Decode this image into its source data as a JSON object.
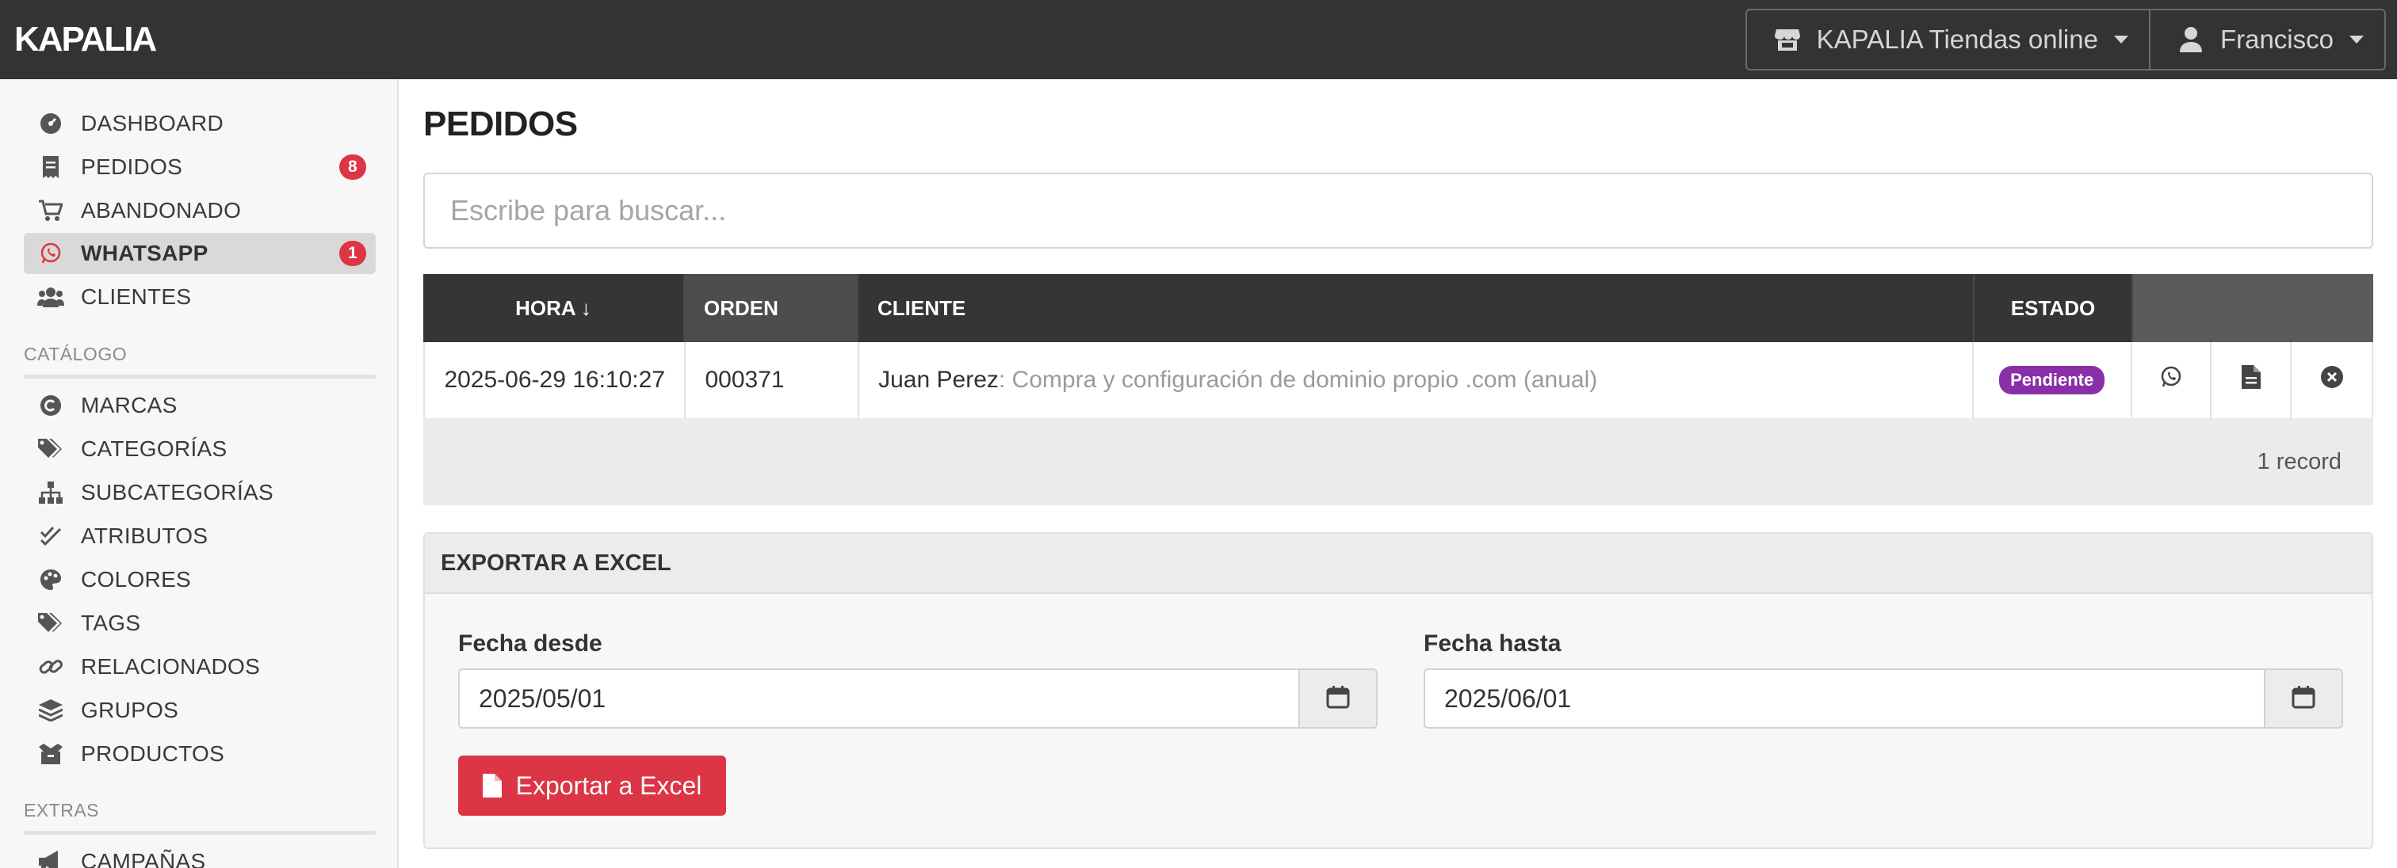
{
  "app": {
    "logo_text": "KAPALIA",
    "store_selector": "KAPALIA Tiendas online",
    "user_menu": "Francisco"
  },
  "sidebar": {
    "main_items": [
      {
        "label": "DASHBOARD",
        "icon": "dashboard-icon"
      },
      {
        "label": "PEDIDOS",
        "icon": "receipt-icon",
        "badge": "8"
      },
      {
        "label": "ABANDONADO",
        "icon": "cart-icon"
      },
      {
        "label": "WHATSAPP",
        "icon": "whatsapp-icon",
        "badge": "1",
        "active": true
      },
      {
        "label": "CLIENTES",
        "icon": "users-icon"
      }
    ],
    "catalog_title": "CATÁLOGO",
    "catalog_items": [
      {
        "label": "MARCAS",
        "icon": "copyright-icon"
      },
      {
        "label": "CATEGORÍAS",
        "icon": "tags-icon"
      },
      {
        "label": "SUBCATEGORÍAS",
        "icon": "sitemap-icon"
      },
      {
        "label": "ATRIBUTOS",
        "icon": "check-double-icon"
      },
      {
        "label": "COLORES",
        "icon": "palette-icon"
      },
      {
        "label": "TAGS",
        "icon": "tags-icon"
      },
      {
        "label": "RELACIONADOS",
        "icon": "link-icon"
      },
      {
        "label": "GRUPOS",
        "icon": "layers-icon"
      },
      {
        "label": "PRODUCTOS",
        "icon": "box-icon"
      }
    ],
    "extras_title": "EXTRAS",
    "extras_items": [
      {
        "label": "CAMPAÑAS",
        "icon": "megaphone-icon"
      }
    ]
  },
  "main": {
    "title": "PEDIDOS",
    "search_placeholder": "Escribe para buscar...",
    "table": {
      "headers": {
        "hora": "HORA ↓",
        "orden": "ORDEN",
        "cliente": "CLIENTE",
        "estado": "ESTADO"
      },
      "rows": [
        {
          "hora": "2025-06-29 16:10:27",
          "orden": "000371",
          "cliente_name": "Juan Perez",
          "cliente_detail": ": Compra y configuración de dominio propio .com (anual)",
          "estado": "Pendiente"
        }
      ],
      "footer": "1 record"
    },
    "export": {
      "title": "EXPORTAR A EXCEL",
      "from_label": "Fecha desde",
      "from_value": "2025/05/01",
      "to_label": "Fecha hasta",
      "to_value": "2025/06/01",
      "button_label": "Exportar a Excel"
    }
  },
  "colors": {
    "topbar": "#333333",
    "badge": "#dc3545",
    "status_pending": "#8b2fa8",
    "export_button": "#dc3545"
  }
}
